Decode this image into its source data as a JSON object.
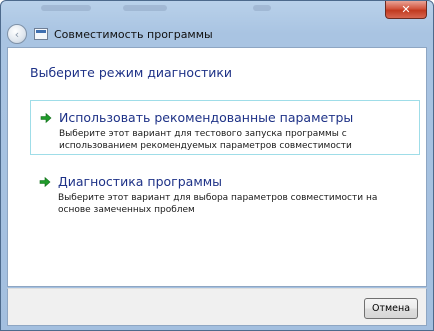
{
  "window": {
    "title": "Совместимость программы",
    "close_glyph": "✕"
  },
  "nav": {
    "back_glyph": "‹"
  },
  "main": {
    "heading": "Выберите режим диагностики",
    "options": [
      {
        "title": "Использовать рекомендованные параметры",
        "description": "Выберите этот вариант для тестового запуска программы с использованием рекомендуемых параметров совместимости",
        "icon": "green-arrow-icon",
        "selected": true
      },
      {
        "title": "Диагностика программы",
        "description": "Выберите этот вариант для выбора параметров совместимости на основе замеченных проблем",
        "icon": "green-arrow-icon",
        "selected": false
      }
    ]
  },
  "footer": {
    "cancel_label": "Отмена"
  },
  "colors": {
    "link_blue": "#1e3287",
    "accent_green": "#1f9b2a",
    "selection_border": "#9fdde8"
  }
}
